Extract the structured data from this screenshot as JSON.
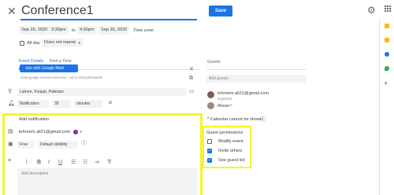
{
  "header": {
    "title_value": "Conference1",
    "save_label": "Save"
  },
  "datetime": {
    "start_date": "Sep 26, 2020",
    "start_time": "3:30pm",
    "to_label": "to",
    "end_time": "4:30pm",
    "end_date": "Sep 26, 2020",
    "timezone_label": "Time zone",
    "allday_label": "All day",
    "repeat_value": "Does not repeat"
  },
  "tabs": {
    "event_details": "Event Details",
    "find_time": "Find a Time",
    "guests": "Guests"
  },
  "conference": {
    "join_label": "Join with Google Meet",
    "meet_info": "meet.google.com/xxx-xxxx-xxx · Up to 100 participants"
  },
  "location": {
    "value": "Lahore, Punjab, Pakistan"
  },
  "notification": {
    "type": "Notification",
    "amount": "30",
    "unit": "minutes",
    "add_label": "Add notification"
  },
  "calendar": {
    "owner": "tehreem.ali21@gmail.com",
    "color": "#8e24aa"
  },
  "visibility": {
    "busy": "Free",
    "visibility": "Default visibility"
  },
  "description": {
    "placeholder": "Add description"
  },
  "guests": {
    "add_placeholder": "Add guests",
    "list": [
      {
        "name": "tehreem.ali21@gmail.com",
        "role": "Organizer",
        "avatar_color": "#7b5e57"
      },
      {
        "name": "Ahsan",
        "role": "",
        "avatar_color": "#a1887f"
      }
    ],
    "calendar_note": "* Calendar cannot be shown",
    "permissions_title": "Guest permissions",
    "permissions": [
      {
        "label": "Modify event",
        "checked": false
      },
      {
        "label": "Invite others",
        "checked": true
      },
      {
        "label": "See guest list",
        "checked": true
      }
    ]
  },
  "side_panel": {
    "icons": [
      "calendar-icon",
      "keep-icon",
      "tasks-icon",
      "maps-icon",
      "add-icon"
    ],
    "colors": [
      "#fbbc04",
      "#fbbc04",
      "#1a73e8",
      "#34a853",
      "#5f6368"
    ]
  }
}
